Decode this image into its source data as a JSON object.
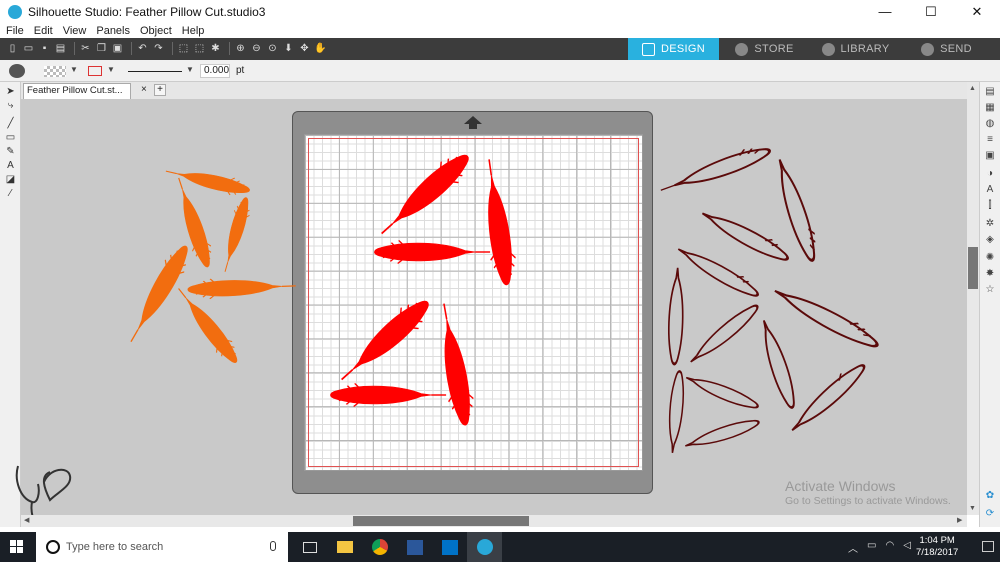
{
  "window": {
    "title": "Silhouette Studio: Feather Pillow Cut.studio3",
    "minimize": "—",
    "maximize": "☐",
    "close": "✕"
  },
  "menu": [
    "File",
    "Edit",
    "View",
    "Panels",
    "Object",
    "Help"
  ],
  "mode_tabs": [
    {
      "label": "DESIGN",
      "active": true
    },
    {
      "label": "STORE",
      "active": false
    },
    {
      "label": "LIBRARY",
      "active": false
    },
    {
      "label": "SEND",
      "active": false
    }
  ],
  "line_toolbar": {
    "line_weight": "0.000",
    "unit": "pt"
  },
  "document": {
    "tab_label": "Feather Pillow Cut.st...",
    "close": "×",
    "add": "+"
  },
  "watermark": {
    "line1": "Activate Windows",
    "line2": "Go to Settings to activate Windows."
  },
  "taskbar": {
    "search_placeholder": "Type here to search",
    "time": "1:04 PM",
    "date": "7/18/2017"
  },
  "colors": {
    "accent": "#29b1df",
    "orange_feathers": "#f26d0f",
    "red_feathers": "#ff0000",
    "outline_feathers": "#5b0a0a"
  }
}
